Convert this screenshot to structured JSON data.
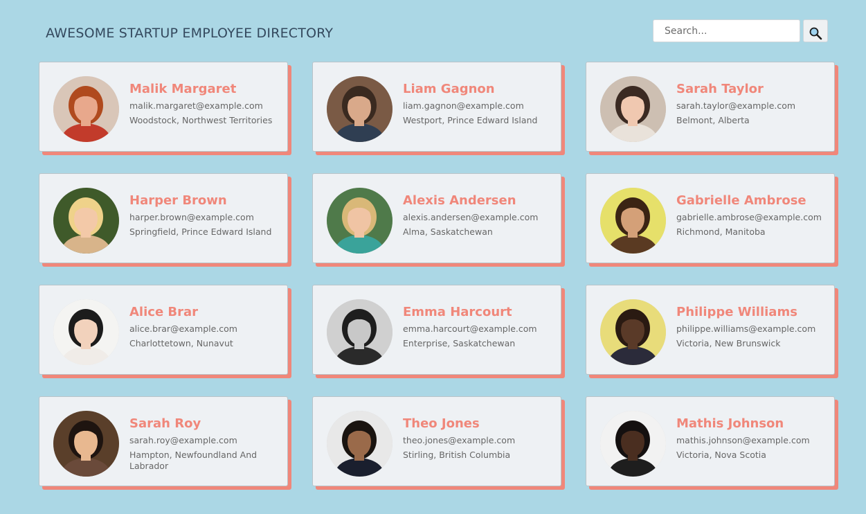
{
  "header": {
    "title": "AWESOME STARTUP EMPLOYEE DIRECTORY",
    "search_placeholder": "Search...",
    "search_value": ""
  },
  "employees": [
    {
      "name": "Malik Margaret",
      "email": "malik.margaret@example.com",
      "location": "Woodstock, Northwest Territories",
      "photo": {
        "bg": "#d9c6b8",
        "skin": "#e8a88c",
        "hair": "#b04a1e",
        "shirt": "#c23b2b"
      }
    },
    {
      "name": "Liam Gagnon",
      "email": "liam.gagnon@example.com",
      "location": "Westport, Prince Edward Island",
      "photo": {
        "bg": "#7a5a45",
        "skin": "#d9a98a",
        "hair": "#3a2a20",
        "shirt": "#2f3e52"
      }
    },
    {
      "name": "Sarah Taylor",
      "email": "sarah.taylor@example.com",
      "location": "Belmont, Alberta",
      "photo": {
        "bg": "#cdbfb2",
        "skin": "#f0c8b0",
        "hair": "#3b2a22",
        "shirt": "#e9e2da"
      }
    },
    {
      "name": "Harper Brown",
      "email": "harper.brown@example.com",
      "location": "Springfield, Prince Edward Island",
      "photo": {
        "bg": "#3f5a2a",
        "skin": "#f3c9a8",
        "hair": "#efd28a",
        "shirt": "#d8b48a"
      }
    },
    {
      "name": "Alexis Andersen",
      "email": "alexis.andersen@example.com",
      "location": "Alma, Saskatchewan",
      "photo": {
        "bg": "#4f7a4a",
        "skin": "#f0c4a4",
        "hair": "#d9b878",
        "shirt": "#3aa39a"
      }
    },
    {
      "name": "Gabrielle Ambrose",
      "email": "gabrielle.ambrose@example.com",
      "location": "Richmond, Manitoba",
      "photo": {
        "bg": "#e6e06a",
        "skin": "#d4a078",
        "hair": "#3b2414",
        "shirt": "#5a3a22"
      }
    },
    {
      "name": "Alice Brar",
      "email": "alice.brar@example.com",
      "location": "Charlottetown, Nunavut",
      "photo": {
        "bg": "#f4f4f2",
        "skin": "#f2d2bc",
        "hair": "#1c1c1c",
        "shirt": "#f0ece8"
      }
    },
    {
      "name": "Emma Harcourt",
      "email": "emma.harcourt@example.com",
      "location": "Enterprise, Saskatchewan",
      "photo": {
        "bg": "#d0d0d0",
        "skin": "#c8c8c8",
        "hair": "#1e1e1e",
        "shirt": "#2a2a2a"
      }
    },
    {
      "name": "Philippe Williams",
      "email": "philippe.williams@example.com",
      "location": "Victoria, New Brunswick",
      "photo": {
        "bg": "#e8dc7a",
        "skin": "#5a3a28",
        "hair": "#2a1a12",
        "shirt": "#2b2b3a"
      }
    },
    {
      "name": "Sarah Roy",
      "email": "sarah.roy@example.com",
      "location": "Hampton, Newfoundland And Labrador",
      "photo": {
        "bg": "#5a3f2a",
        "skin": "#e8b890",
        "hair": "#1e1410",
        "shirt": "#6a4a3a"
      }
    },
    {
      "name": "Theo Jones",
      "email": "theo.jones@example.com",
      "location": "Stirling, British Columbia",
      "photo": {
        "bg": "#e8e8e8",
        "skin": "#9a6a4a",
        "hair": "#1a1410",
        "shirt": "#1a1f2e"
      }
    },
    {
      "name": "Mathis Johnson",
      "email": "mathis.johnson@example.com",
      "location": "Victoria, Nova Scotia",
      "photo": {
        "bg": "#f2f2f2",
        "skin": "#4a2e20",
        "hair": "#141010",
        "shirt": "#1e1e1e"
      }
    }
  ]
}
